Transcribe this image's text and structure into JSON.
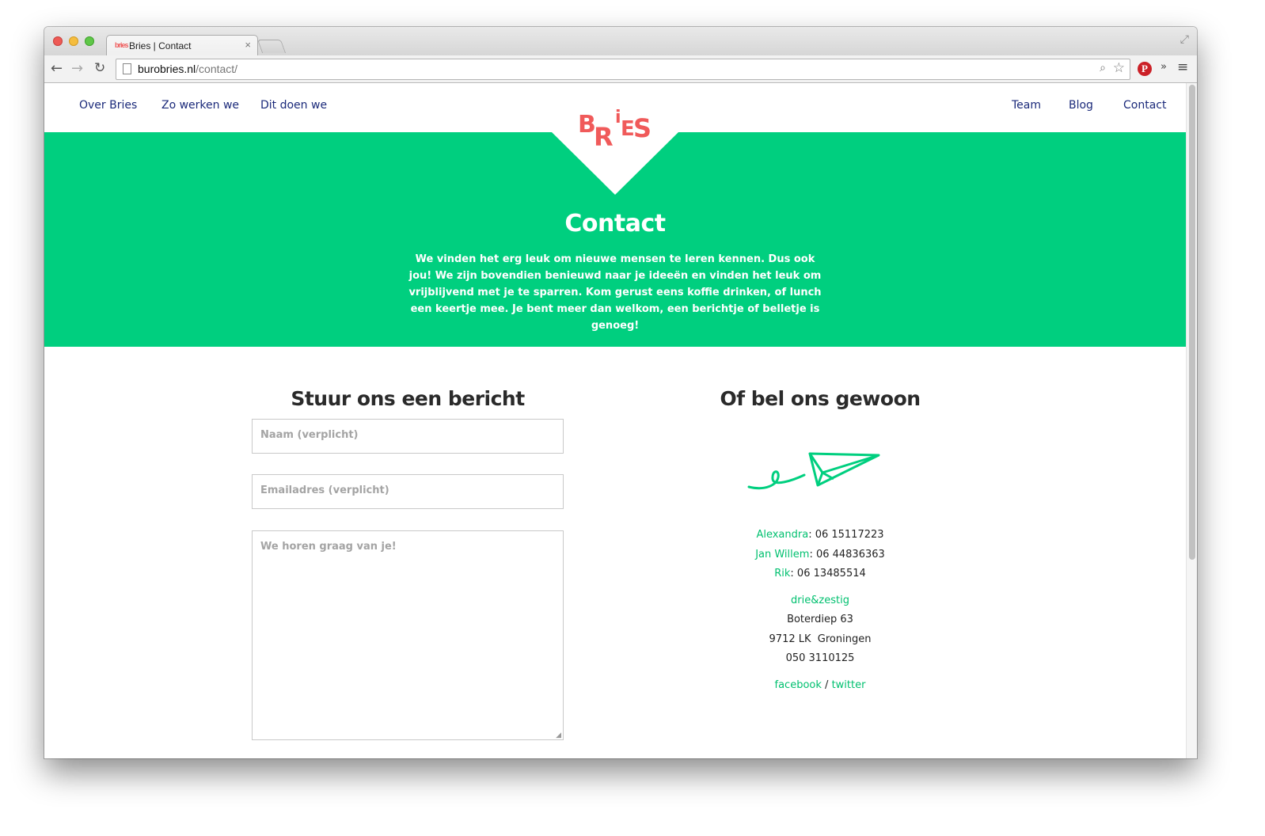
{
  "browser": {
    "tab_title": "Bries | Contact",
    "tab_favicon": "bries-logo",
    "tab_close": "×",
    "url_host": "burobries.nl",
    "url_path": "/contact/"
  },
  "nav": {
    "left": [
      "Over Bries",
      "Zo werken we",
      "Dit doen we"
    ],
    "right": [
      "Team",
      "Blog",
      "Contact"
    ],
    "logo_text": "BRiES"
  },
  "hero": {
    "title": "Contact",
    "text": "We vinden het erg leuk om nieuwe mensen te leren kennen. Dus ook jou! We zijn bovendien benieuwd naar je ideeën en vinden het leuk om vrijblijvend met je te sparren. Kom gerust eens koffie drinken, of lunch een keertje mee. Je bent meer dan welkom, een berichtje of belletje is genoeg!"
  },
  "form": {
    "heading": "Stuur ons een bericht",
    "name_placeholder": "Naam (verplicht)",
    "email_placeholder": "Emailadres (verplicht)",
    "message_placeholder": "We horen graag van je!"
  },
  "contact": {
    "heading": "Of bel ons gewoon",
    "people": [
      {
        "name": "Alexandra",
        "phone": ": 06 15117223"
      },
      {
        "name": "Jan Willem",
        "phone": ": 06 44836363"
      },
      {
        "name": "Rik",
        "phone": ": 06 13485514"
      }
    ],
    "company": "drie&zestig",
    "street": "Boterdiep 63",
    "city": "9712 LK  Groningen",
    "phone": "050 3110125",
    "facebook": "facebook",
    "separator": "/",
    "twitter": "twitter"
  },
  "colors": {
    "accent_green": "#00cf7f",
    "logo_red": "#f05a5a",
    "nav_blue": "#1b2a7a"
  }
}
